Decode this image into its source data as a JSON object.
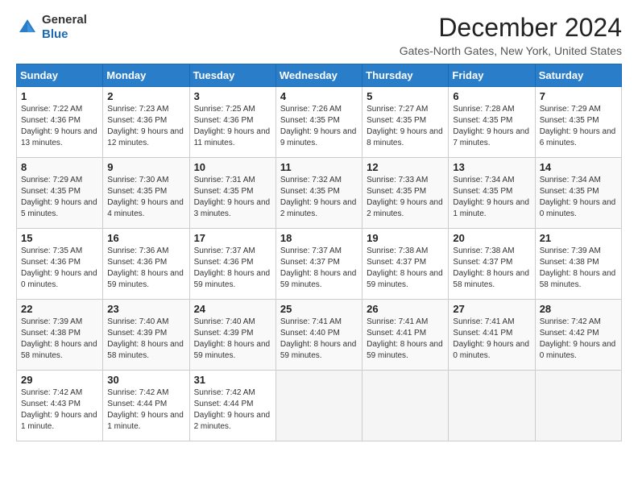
{
  "header": {
    "logo": {
      "general": "General",
      "blue": "Blue"
    },
    "title": "December 2024",
    "location": "Gates-North Gates, New York, United States"
  },
  "columns": [
    "Sunday",
    "Monday",
    "Tuesday",
    "Wednesday",
    "Thursday",
    "Friday",
    "Saturday"
  ],
  "weeks": [
    [
      {
        "day": 1,
        "sunrise": "7:22 AM",
        "sunset": "4:36 PM",
        "daylight": "9 hours and 13 minutes."
      },
      {
        "day": 2,
        "sunrise": "7:23 AM",
        "sunset": "4:36 PM",
        "daylight": "9 hours and 12 minutes."
      },
      {
        "day": 3,
        "sunrise": "7:25 AM",
        "sunset": "4:36 PM",
        "daylight": "9 hours and 11 minutes."
      },
      {
        "day": 4,
        "sunrise": "7:26 AM",
        "sunset": "4:35 PM",
        "daylight": "9 hours and 9 minutes."
      },
      {
        "day": 5,
        "sunrise": "7:27 AM",
        "sunset": "4:35 PM",
        "daylight": "9 hours and 8 minutes."
      },
      {
        "day": 6,
        "sunrise": "7:28 AM",
        "sunset": "4:35 PM",
        "daylight": "9 hours and 7 minutes."
      },
      {
        "day": 7,
        "sunrise": "7:29 AM",
        "sunset": "4:35 PM",
        "daylight": "9 hours and 6 minutes."
      }
    ],
    [
      {
        "day": 8,
        "sunrise": "7:29 AM",
        "sunset": "4:35 PM",
        "daylight": "9 hours and 5 minutes."
      },
      {
        "day": 9,
        "sunrise": "7:30 AM",
        "sunset": "4:35 PM",
        "daylight": "9 hours and 4 minutes."
      },
      {
        "day": 10,
        "sunrise": "7:31 AM",
        "sunset": "4:35 PM",
        "daylight": "9 hours and 3 minutes."
      },
      {
        "day": 11,
        "sunrise": "7:32 AM",
        "sunset": "4:35 PM",
        "daylight": "9 hours and 2 minutes."
      },
      {
        "day": 12,
        "sunrise": "7:33 AM",
        "sunset": "4:35 PM",
        "daylight": "9 hours and 2 minutes."
      },
      {
        "day": 13,
        "sunrise": "7:34 AM",
        "sunset": "4:35 PM",
        "daylight": "9 hours and 1 minute."
      },
      {
        "day": 14,
        "sunrise": "7:34 AM",
        "sunset": "4:35 PM",
        "daylight": "9 hours and 0 minutes."
      }
    ],
    [
      {
        "day": 15,
        "sunrise": "7:35 AM",
        "sunset": "4:36 PM",
        "daylight": "9 hours and 0 minutes."
      },
      {
        "day": 16,
        "sunrise": "7:36 AM",
        "sunset": "4:36 PM",
        "daylight": "8 hours and 59 minutes."
      },
      {
        "day": 17,
        "sunrise": "7:37 AM",
        "sunset": "4:36 PM",
        "daylight": "8 hours and 59 minutes."
      },
      {
        "day": 18,
        "sunrise": "7:37 AM",
        "sunset": "4:37 PM",
        "daylight": "8 hours and 59 minutes."
      },
      {
        "day": 19,
        "sunrise": "7:38 AM",
        "sunset": "4:37 PM",
        "daylight": "8 hours and 59 minutes."
      },
      {
        "day": 20,
        "sunrise": "7:38 AM",
        "sunset": "4:37 PM",
        "daylight": "8 hours and 58 minutes."
      },
      {
        "day": 21,
        "sunrise": "7:39 AM",
        "sunset": "4:38 PM",
        "daylight": "8 hours and 58 minutes."
      }
    ],
    [
      {
        "day": 22,
        "sunrise": "7:39 AM",
        "sunset": "4:38 PM",
        "daylight": "8 hours and 58 minutes."
      },
      {
        "day": 23,
        "sunrise": "7:40 AM",
        "sunset": "4:39 PM",
        "daylight": "8 hours and 58 minutes."
      },
      {
        "day": 24,
        "sunrise": "7:40 AM",
        "sunset": "4:39 PM",
        "daylight": "8 hours and 59 minutes."
      },
      {
        "day": 25,
        "sunrise": "7:41 AM",
        "sunset": "4:40 PM",
        "daylight": "8 hours and 59 minutes."
      },
      {
        "day": 26,
        "sunrise": "7:41 AM",
        "sunset": "4:41 PM",
        "daylight": "8 hours and 59 minutes."
      },
      {
        "day": 27,
        "sunrise": "7:41 AM",
        "sunset": "4:41 PM",
        "daylight": "9 hours and 0 minutes."
      },
      {
        "day": 28,
        "sunrise": "7:42 AM",
        "sunset": "4:42 PM",
        "daylight": "9 hours and 0 minutes."
      }
    ],
    [
      {
        "day": 29,
        "sunrise": "7:42 AM",
        "sunset": "4:43 PM",
        "daylight": "9 hours and 1 minute."
      },
      {
        "day": 30,
        "sunrise": "7:42 AM",
        "sunset": "4:44 PM",
        "daylight": "9 hours and 1 minute."
      },
      {
        "day": 31,
        "sunrise": "7:42 AM",
        "sunset": "4:44 PM",
        "daylight": "9 hours and 2 minutes."
      },
      null,
      null,
      null,
      null
    ]
  ]
}
